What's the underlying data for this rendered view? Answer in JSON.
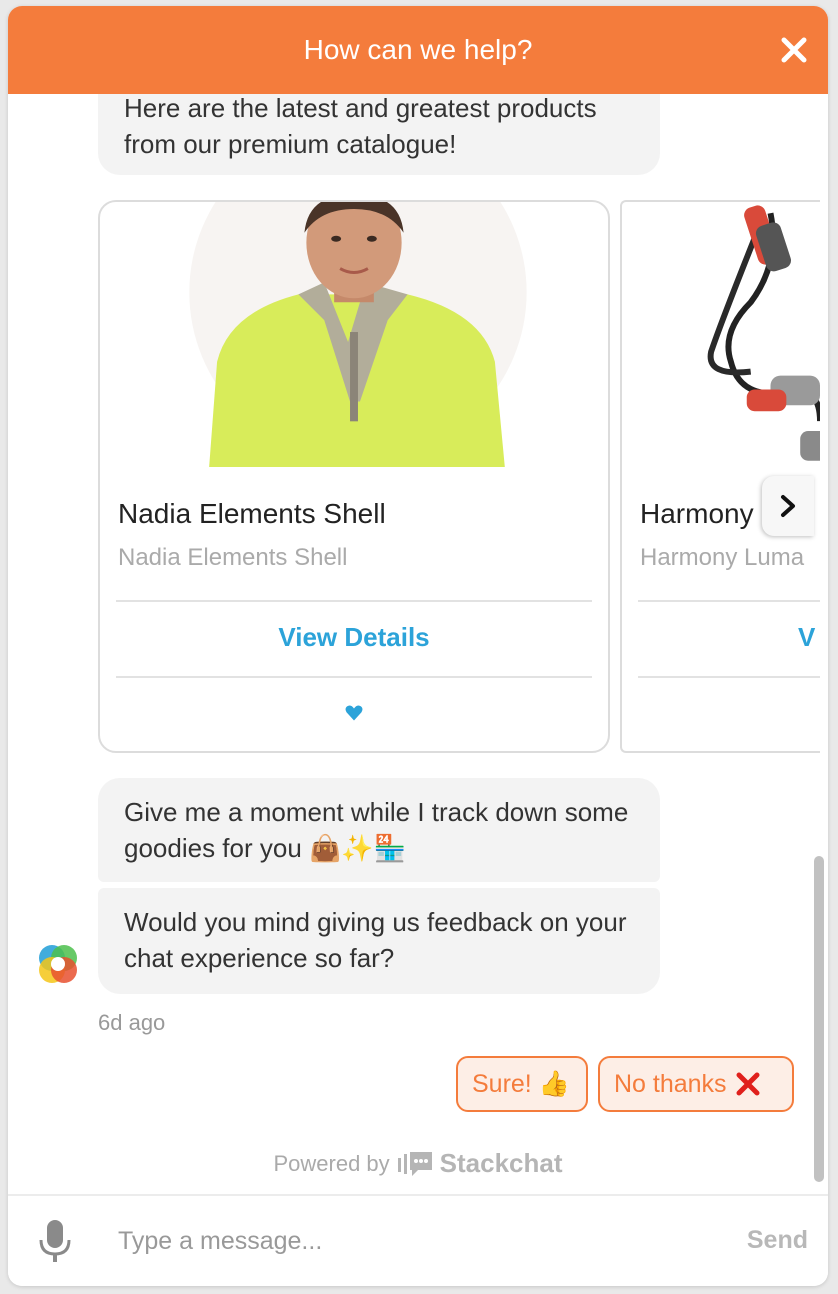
{
  "header": {
    "title": "How can we help?",
    "close_icon": "close-icon"
  },
  "messages": [
    {
      "text": "Here are the latest and greatest products from our premium catalogue!"
    },
    {
      "text": "Give me a moment while I track down some goodies for you 👜✨🏪"
    },
    {
      "text": "Would you mind giving us feedback on your chat experience so far?"
    }
  ],
  "carousel": {
    "cards": [
      {
        "title": "Nadia Elements Shell",
        "subtitle": "Nadia Elements Shell",
        "button": "View Details",
        "favorite_icon": "heart-icon"
      },
      {
        "title": "Harmony",
        "subtitle": "Harmony Luma",
        "button": "V"
      }
    ],
    "next_icon": "chevron-right-icon"
  },
  "timestamp": "6d ago",
  "quick_replies": [
    {
      "label": "Sure! 👍"
    },
    {
      "label": "No thanks",
      "icon": "red-x-icon"
    }
  ],
  "powered_by": {
    "label": "Powered by",
    "brand": "Stackchat"
  },
  "composer": {
    "placeholder": "Type a message...",
    "send_label": "Send",
    "mic_icon": "microphone-icon"
  },
  "colors": {
    "accent": "#f47c3c",
    "link": "#2ca3d9",
    "bubble": "#f3f3f3"
  }
}
